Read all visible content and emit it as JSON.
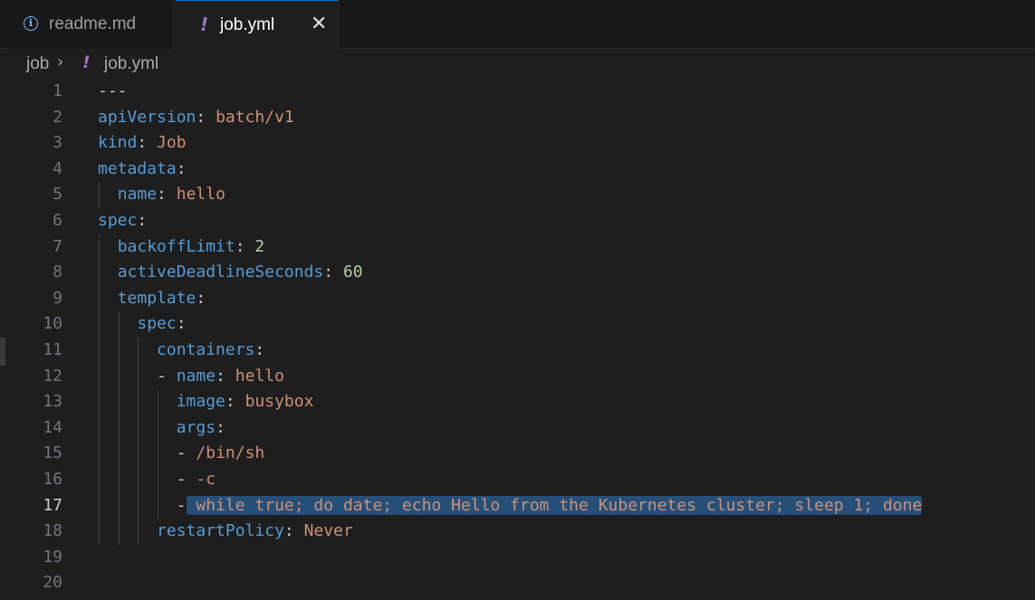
{
  "tabs": [
    {
      "label": "readme.md",
      "icon": "info-icon",
      "active": false
    },
    {
      "label": "job.yml",
      "icon": "yaml-icon",
      "active": true
    }
  ],
  "tab_icons": {
    "yaml_glyph": "!",
    "info_glyph": "i",
    "close_glyph": "✕"
  },
  "breadcrumb": {
    "folder": "job",
    "separator": "›",
    "file": "job.yml"
  },
  "editor": {
    "current_line": 17,
    "lines": [
      {
        "n": "1",
        "tokens": [
          {
            "t": "---",
            "c": "p"
          }
        ]
      },
      {
        "n": "2",
        "tokens": [
          {
            "t": "apiVersion",
            "c": "k"
          },
          {
            "t": ": ",
            "c": "p"
          },
          {
            "t": "batch/v1",
            "c": "s"
          }
        ]
      },
      {
        "n": "3",
        "tokens": [
          {
            "t": "kind",
            "c": "k"
          },
          {
            "t": ": ",
            "c": "p"
          },
          {
            "t": "Job",
            "c": "s"
          }
        ]
      },
      {
        "n": "4",
        "tokens": [
          {
            "t": "metadata",
            "c": "k"
          },
          {
            "t": ":",
            "c": "p"
          }
        ]
      },
      {
        "n": "5",
        "tokens": [
          {
            "t": "  ",
            "c": "p"
          },
          {
            "t": "name",
            "c": "k"
          },
          {
            "t": ": ",
            "c": "p"
          },
          {
            "t": "hello",
            "c": "s"
          }
        ]
      },
      {
        "n": "6",
        "tokens": [
          {
            "t": "spec",
            "c": "k"
          },
          {
            "t": ":",
            "c": "p"
          }
        ]
      },
      {
        "n": "7",
        "tokens": [
          {
            "t": "  ",
            "c": "p"
          },
          {
            "t": "backoffLimit",
            "c": "k"
          },
          {
            "t": ": ",
            "c": "p"
          },
          {
            "t": "2",
            "c": "n"
          }
        ]
      },
      {
        "n": "8",
        "tokens": [
          {
            "t": "  ",
            "c": "p"
          },
          {
            "t": "activeDeadlineSeconds",
            "c": "k"
          },
          {
            "t": ": ",
            "c": "p"
          },
          {
            "t": "60",
            "c": "n"
          }
        ]
      },
      {
        "n": "9",
        "tokens": [
          {
            "t": "  ",
            "c": "p"
          },
          {
            "t": "template",
            "c": "k"
          },
          {
            "t": ":",
            "c": "p"
          }
        ]
      },
      {
        "n": "10",
        "tokens": [
          {
            "t": "    ",
            "c": "p"
          },
          {
            "t": "spec",
            "c": "k"
          },
          {
            "t": ":",
            "c": "p"
          }
        ]
      },
      {
        "n": "11",
        "tokens": [
          {
            "t": "      ",
            "c": "p"
          },
          {
            "t": "containers",
            "c": "k"
          },
          {
            "t": ":",
            "c": "p"
          }
        ]
      },
      {
        "n": "12",
        "tokens": [
          {
            "t": "      ",
            "c": "p"
          },
          {
            "t": "- ",
            "c": "p"
          },
          {
            "t": "name",
            "c": "k"
          },
          {
            "t": ": ",
            "c": "p"
          },
          {
            "t": "hello",
            "c": "s"
          }
        ]
      },
      {
        "n": "13",
        "tokens": [
          {
            "t": "        ",
            "c": "p"
          },
          {
            "t": "image",
            "c": "k"
          },
          {
            "t": ": ",
            "c": "p"
          },
          {
            "t": "busybox",
            "c": "s"
          }
        ]
      },
      {
        "n": "14",
        "tokens": [
          {
            "t": "        ",
            "c": "p"
          },
          {
            "t": "args",
            "c": "k"
          },
          {
            "t": ":",
            "c": "p"
          }
        ]
      },
      {
        "n": "15",
        "tokens": [
          {
            "t": "        ",
            "c": "p"
          },
          {
            "t": "- ",
            "c": "p"
          },
          {
            "t": "/bin/sh",
            "c": "s"
          }
        ]
      },
      {
        "n": "16",
        "tokens": [
          {
            "t": "        ",
            "c": "p"
          },
          {
            "t": "- ",
            "c": "p"
          },
          {
            "t": "-c",
            "c": "s"
          }
        ]
      },
      {
        "n": "17",
        "tokens": [
          {
            "t": "        ",
            "c": "p"
          },
          {
            "t": "-",
            "c": "p"
          },
          {
            "t": " while true; do date; echo Hello from the Kubernetes cluster; sleep 1; done",
            "c": "s sel"
          }
        ]
      },
      {
        "n": "18",
        "tokens": [
          {
            "t": "      ",
            "c": "p"
          },
          {
            "t": "restartPolicy",
            "c": "k"
          },
          {
            "t": ": ",
            "c": "p"
          },
          {
            "t": "Never",
            "c": "s"
          }
        ]
      },
      {
        "n": "19",
        "tokens": []
      },
      {
        "n": "20",
        "tokens": []
      }
    ]
  },
  "colors": {
    "background": "#1e1e1e",
    "key": "#569cd6",
    "string": "#ce9178",
    "number": "#b5cea8",
    "selection": "#264f78",
    "yaml_icon": "#a074c4",
    "info_icon": "#75beff"
  }
}
